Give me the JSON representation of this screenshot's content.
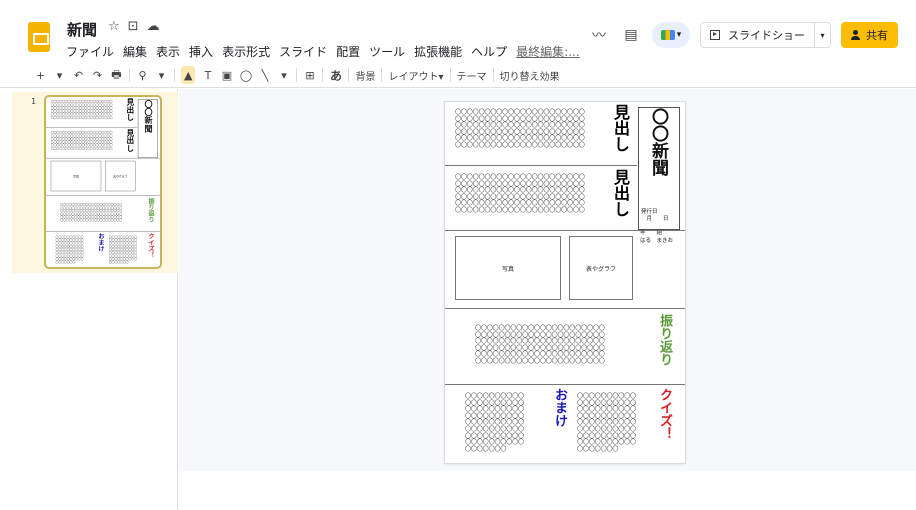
{
  "app": {
    "doc_title": "新聞",
    "menus": [
      "ファイル",
      "編集",
      "表示",
      "挿入",
      "表示形式",
      "スライド",
      "配置",
      "ツール",
      "拡張機能",
      "ヘルプ"
    ],
    "last_edit": "最終編集:...",
    "slideshow_label": "スライドショー",
    "share_label": "共有",
    "accent": "#fbbc04"
  },
  "toolbar": {
    "items": [
      "+",
      "▾",
      "↶",
      "↷",
      "🖶",
      "⚲",
      "▾",
      "▲",
      "T",
      "▣",
      "◯",
      "╲",
      "▾",
      "⊞",
      "あ"
    ],
    "background_label": "背景",
    "layout_label": "レイアウト▾",
    "theme_label": "テーマ",
    "transition_label": "切り替え効果"
  },
  "filmstrip": {
    "slide_number": "1"
  },
  "slide": {
    "headline1": "見出し",
    "headline2": "見出し",
    "newspaper_title": "〇〇新聞",
    "issue_date": "発行日\n　月　　日",
    "class_line": "年　　組\nはる　まきお",
    "photo_label": "写真",
    "chart_label": "表やグラフ",
    "reflection": "振り返り",
    "omake": "おまけ",
    "quiz": "クイズ！",
    "block_wide": "〇〇〇〇〇〇〇〇〇〇〇〇〇〇〇〇〇〇〇〇〇〇\n〇〇〇〇〇〇〇〇〇〇〇〇〇〇〇〇〇〇〇〇〇〇\n〇〇〇〇〇〇〇〇〇〇〇〇〇〇〇〇〇〇〇〇〇〇\n〇〇〇〇〇〇〇〇〇〇〇〇〇〇〇〇〇〇〇〇〇〇\n〇〇〇〇〇〇〇〇〇〇〇〇〇〇〇〇〇〇〇〇〇〇\n〇〇〇〇〇〇〇〇〇〇〇〇〇〇〇〇〇〇〇〇〇〇\n〇〇〇〇〇〇〇〇〇〇〇",
    "block_mid": "〇〇〇〇〇〇〇〇〇〇〇〇〇〇〇〇〇〇〇〇〇〇\n〇〇〇〇〇〇〇〇〇〇〇〇〇〇〇〇〇〇〇〇〇〇\n〇〇〇〇〇〇〇〇〇〇〇〇〇〇〇〇〇〇〇〇〇〇\n〇〇〇〇〇〇〇〇〇〇〇〇〇〇〇〇〇〇〇〇〇〇\n〇〇〇〇〇〇〇〇〇〇〇〇〇〇〇〇〇〇〇〇〇〇\n〇〇〇〇〇〇〇〇〇〇〇〇〇〇〇〇〇〇〇〇〇〇",
    "block_small": "〇〇〇〇〇〇〇〇〇〇\n〇〇〇〇〇〇〇〇〇〇\n〇〇〇〇〇〇〇〇〇〇\n〇〇〇〇〇〇〇〇〇〇\n〇〇〇〇〇〇〇〇〇〇\n〇〇〇〇〇〇〇〇〇〇\n〇〇〇〇〇〇〇〇〇〇\n〇〇〇〇〇〇〇〇〇〇\n〇〇〇〇〇〇〇"
  }
}
